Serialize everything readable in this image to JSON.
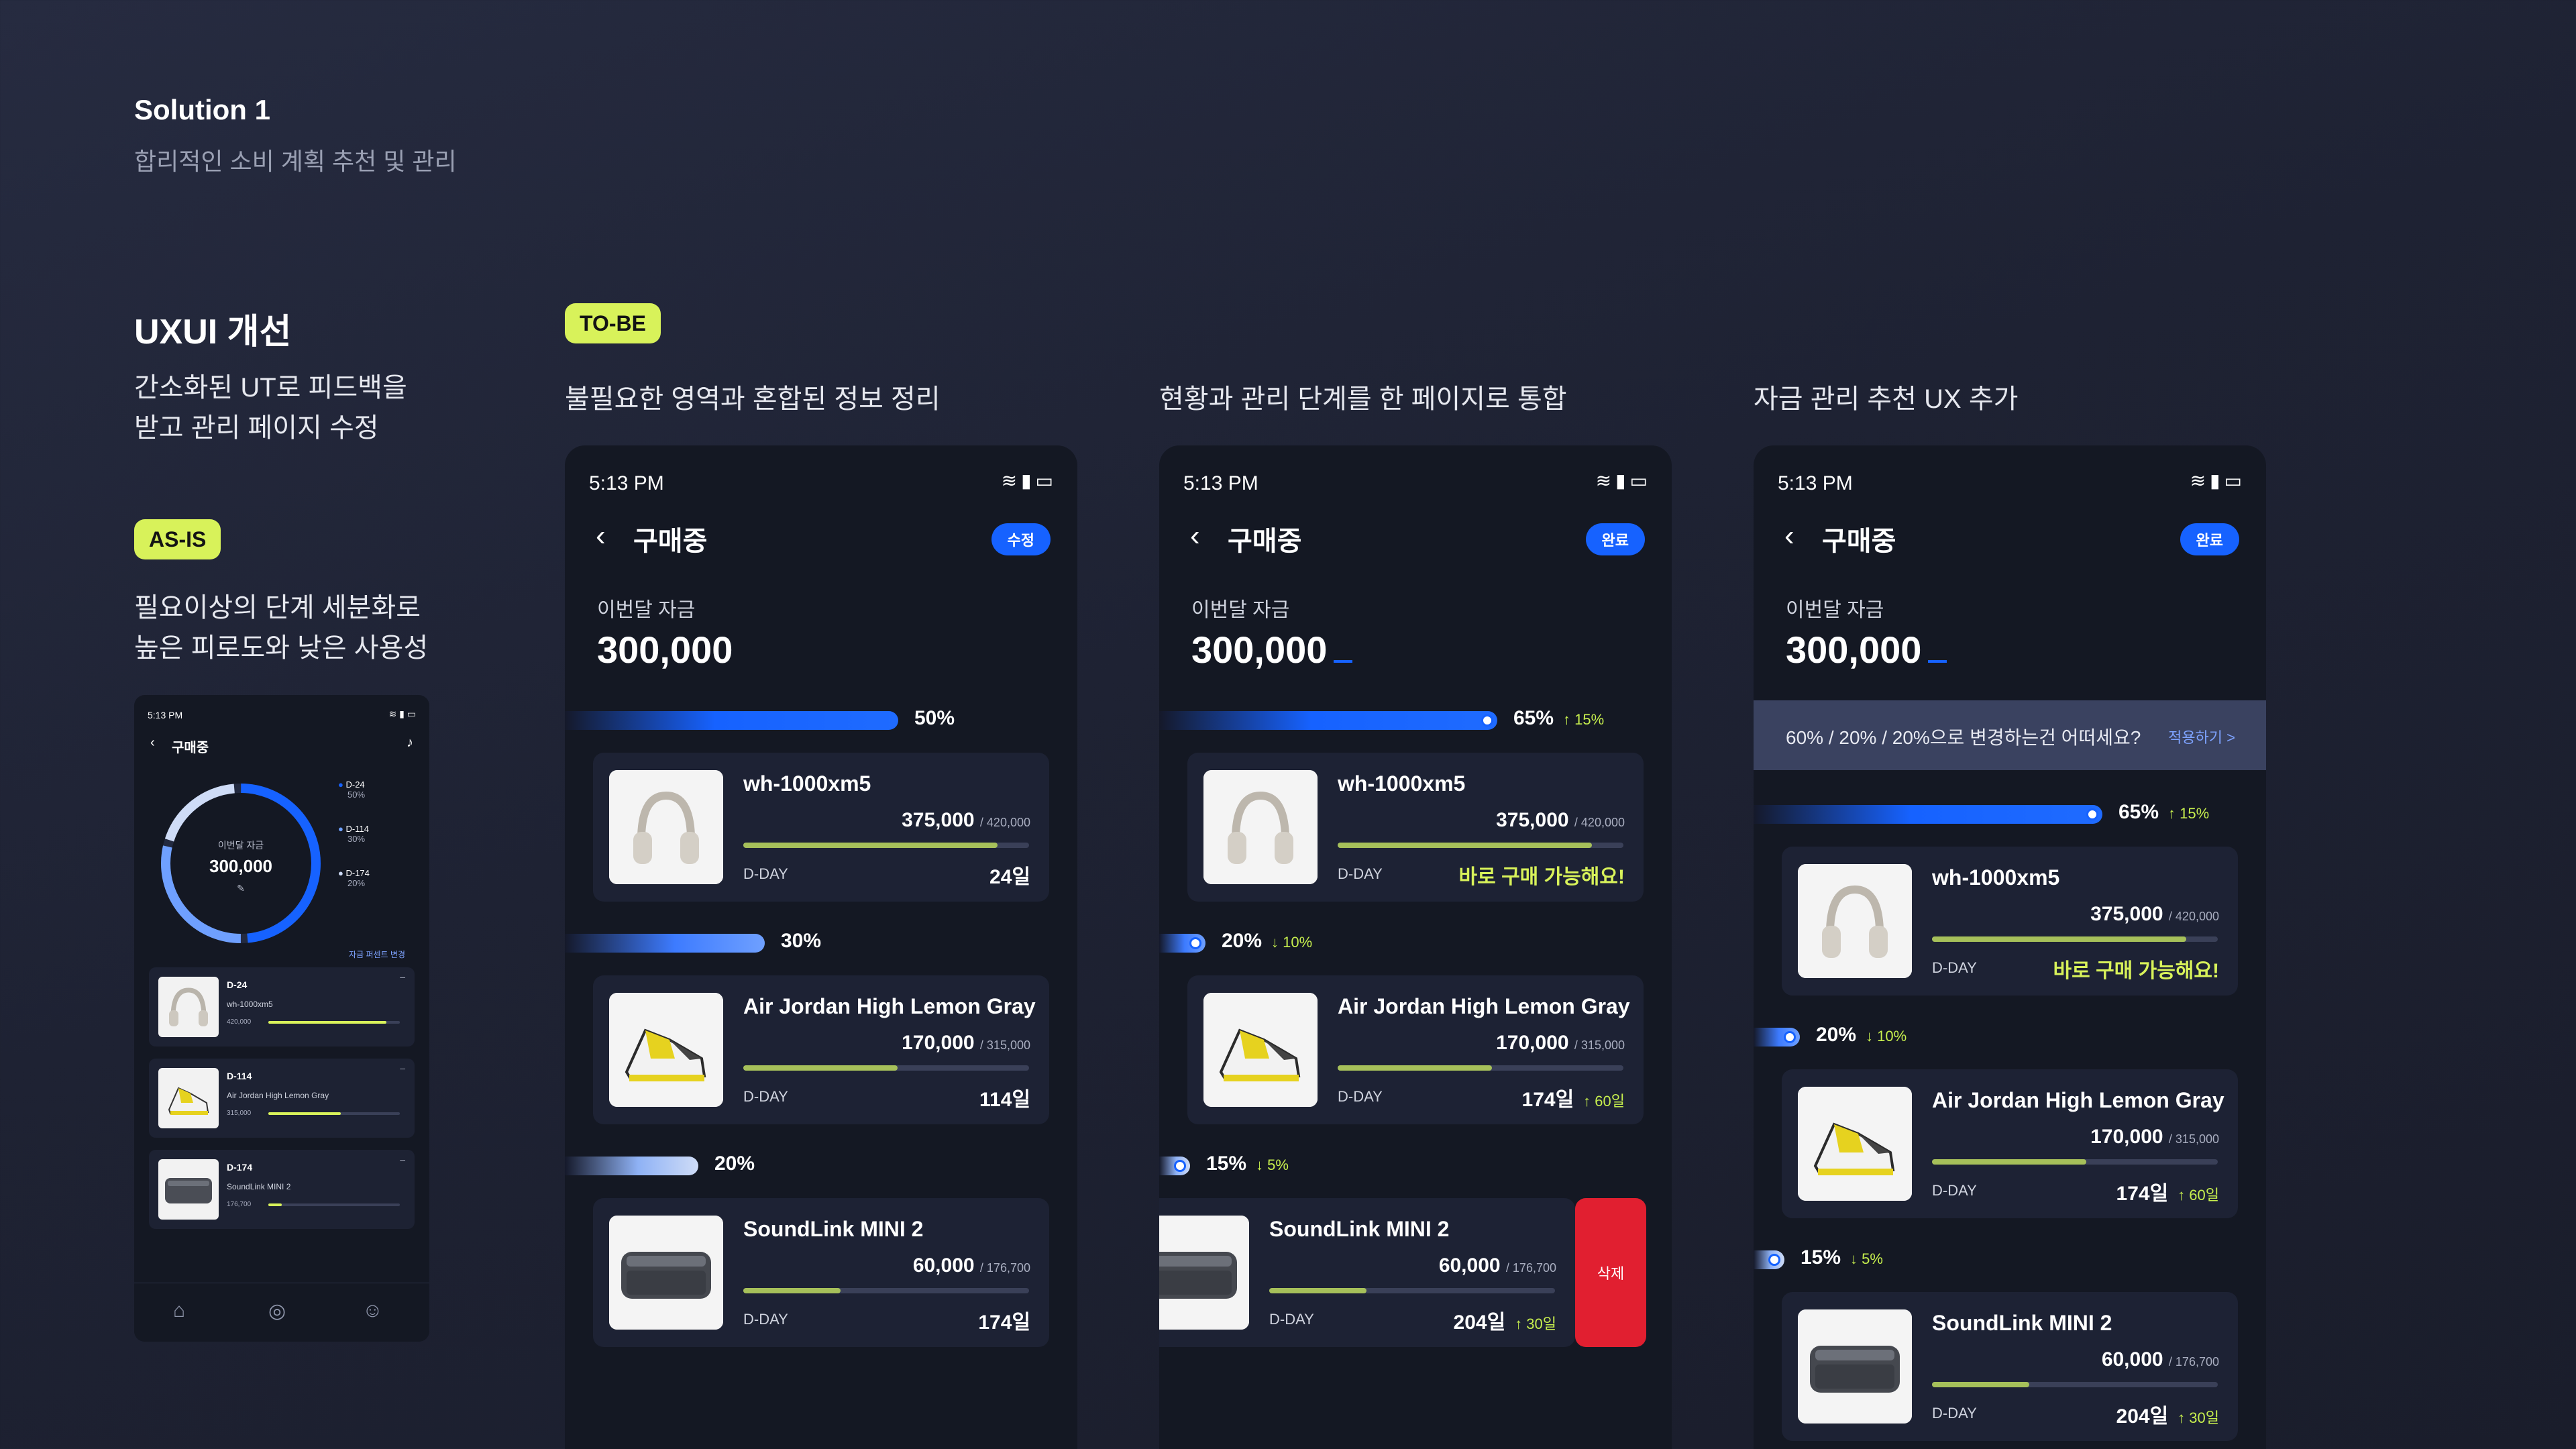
{
  "header": {
    "title": "Solution 1",
    "subtitle": "합리적인 소비 계획 추천 및 관리"
  },
  "left": {
    "title": "UXUI 개선",
    "desc_line1": "간소화된 UT로 피드백을",
    "desc_line2": "받고 관리 페이지 수정",
    "asis_badge": "AS-IS",
    "asis_line1": "필요이상의 단계 세분화로",
    "asis_line2": "높은 피로도와 낮은 사용성"
  },
  "tobe_badge": "TO-BE",
  "columns": [
    "불필요한 영역과 혼합된 정보 정리",
    "현황과 관리 단계를 한 페이지로 통합",
    "자금 관리 추천 UX 추가"
  ],
  "mini": {
    "time": "5:13 PM",
    "title": "구매중",
    "ring_label": "이번달 자금",
    "ring_value": "300,000",
    "legend": [
      {
        "d": "D-24",
        "p": "50%"
      },
      {
        "d": "D-114",
        "p": "30%"
      },
      {
        "d": "D-174",
        "p": "20%"
      }
    ],
    "ratio_link": "자금 퍼센트 변경",
    "ring_shares": [
      0.5,
      0.3,
      0.2
    ],
    "items": [
      {
        "dday": "D-24",
        "name": "wh-1000xm5",
        "price": "420,000",
        "progress": 0.9
      },
      {
        "dday": "D-114",
        "name": "Air Jordan High Lemon Gray",
        "price": "315,000",
        "progress": 0.55
      },
      {
        "dday": "D-174",
        "name": "SoundLink MINI 2",
        "price": "176,700",
        "progress": 0.1
      }
    ]
  },
  "common": {
    "time": "5:13 PM",
    "page_title": "구매중",
    "fund_label": "이번달 자금",
    "fund_value": "300,000",
    "dday_label": "D-DAY"
  },
  "phones": [
    {
      "button": "수정",
      "rows": [
        {
          "pct": "50%",
          "delta": "",
          "name": "wh-1000xm5",
          "price": "375,000",
          "total": "/ 420,000",
          "days": "24일",
          "days_delta": "",
          "ok": "",
          "progress": 0.89
        },
        {
          "pct": "30%",
          "delta": "",
          "name": "Air Jordan High Lemon Gray",
          "price": "170,000",
          "total": "/ 315,000",
          "days": "114일",
          "days_delta": "",
          "ok": "",
          "progress": 0.54
        },
        {
          "pct": "20%",
          "delta": "",
          "name": "SoundLink MINI 2",
          "price": "60,000",
          "total": "/ 176,700",
          "days": "174일",
          "days_delta": "",
          "ok": "",
          "progress": 0.34
        }
      ]
    },
    {
      "button": "완료",
      "rows": [
        {
          "pct": "65%",
          "delta": "↑ 15%",
          "name": "wh-1000xm5",
          "price": "375,000",
          "total": "/ 420,000",
          "days": "",
          "days_delta": "",
          "ok": "바로 구매 가능해요!",
          "progress": 0.89
        },
        {
          "pct": "20%",
          "delta": "↓ 10%",
          "name": "Air Jordan High Lemon Gray",
          "price": "170,000",
          "total": "/ 315,000",
          "days": "174일",
          "days_delta": "↑ 60일",
          "ok": "",
          "progress": 0.54
        },
        {
          "pct": "15%",
          "delta": "↓ 5%",
          "name": "SoundLink MINI 2",
          "price": "60,000",
          "total": "/ 176,700",
          "days": "204일",
          "days_delta": "↑ 30일",
          "ok": "",
          "progress": 0.34
        }
      ],
      "delete_label": "삭제"
    },
    {
      "button": "완료",
      "suggest_text": "60% / 20% / 20%으로 변경하는건 어떠세요?",
      "suggest_action": "적용하기 >",
      "rows": [
        {
          "pct": "65%",
          "delta": "↑ 15%",
          "name": "wh-1000xm5",
          "price": "375,000",
          "total": "/ 420,000",
          "days": "",
          "days_delta": "",
          "ok": "바로 구매 가능해요!",
          "progress": 0.89
        },
        {
          "pct": "20%",
          "delta": "↓ 10%",
          "name": "Air Jordan High Lemon Gray",
          "price": "170,000",
          "total": "/ 315,000",
          "days": "174일",
          "days_delta": "↑ 60일",
          "ok": "",
          "progress": 0.54
        },
        {
          "pct": "15%",
          "delta": "↓ 5%",
          "name": "SoundLink MINI 2",
          "price": "60,000",
          "total": "/ 176,700",
          "days": "204일",
          "days_delta": "↑ 30일",
          "ok": "",
          "progress": 0.34
        }
      ]
    }
  ],
  "colors": {
    "accent": "#1662ff",
    "lime": "#d8f25a",
    "danger": "#e11f30",
    "bg": "#1e2233"
  }
}
